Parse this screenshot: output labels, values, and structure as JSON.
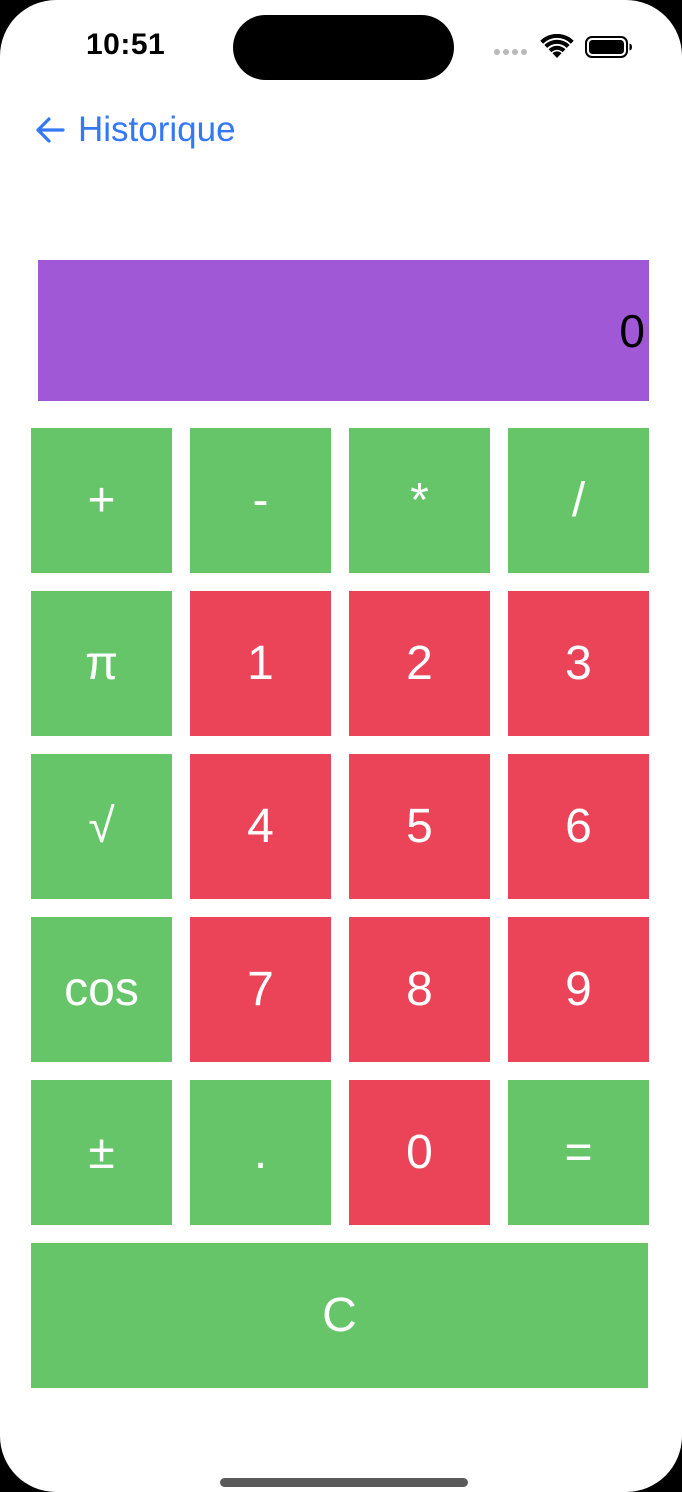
{
  "status_bar": {
    "time": "10:51"
  },
  "nav": {
    "back_label": "Historique",
    "back_icon": "arrow-left-icon"
  },
  "display": {
    "value": "0",
    "color": "#a058d6"
  },
  "colors": {
    "operator_key": "#67c569",
    "digit_key": "#eb4459",
    "link": "#3478f6"
  },
  "keys": {
    "plus": "+",
    "minus": "-",
    "multiply": "*",
    "divide": "/",
    "pi": "π",
    "one": "1",
    "two": "2",
    "three": "3",
    "sqrt": "√",
    "four": "4",
    "five": "5",
    "six": "6",
    "cos": "cos",
    "seven": "7",
    "eight": "8",
    "nine": "9",
    "plus_minus": "±",
    "decimal": ".",
    "zero": "0",
    "equals": "=",
    "clear": "C"
  }
}
